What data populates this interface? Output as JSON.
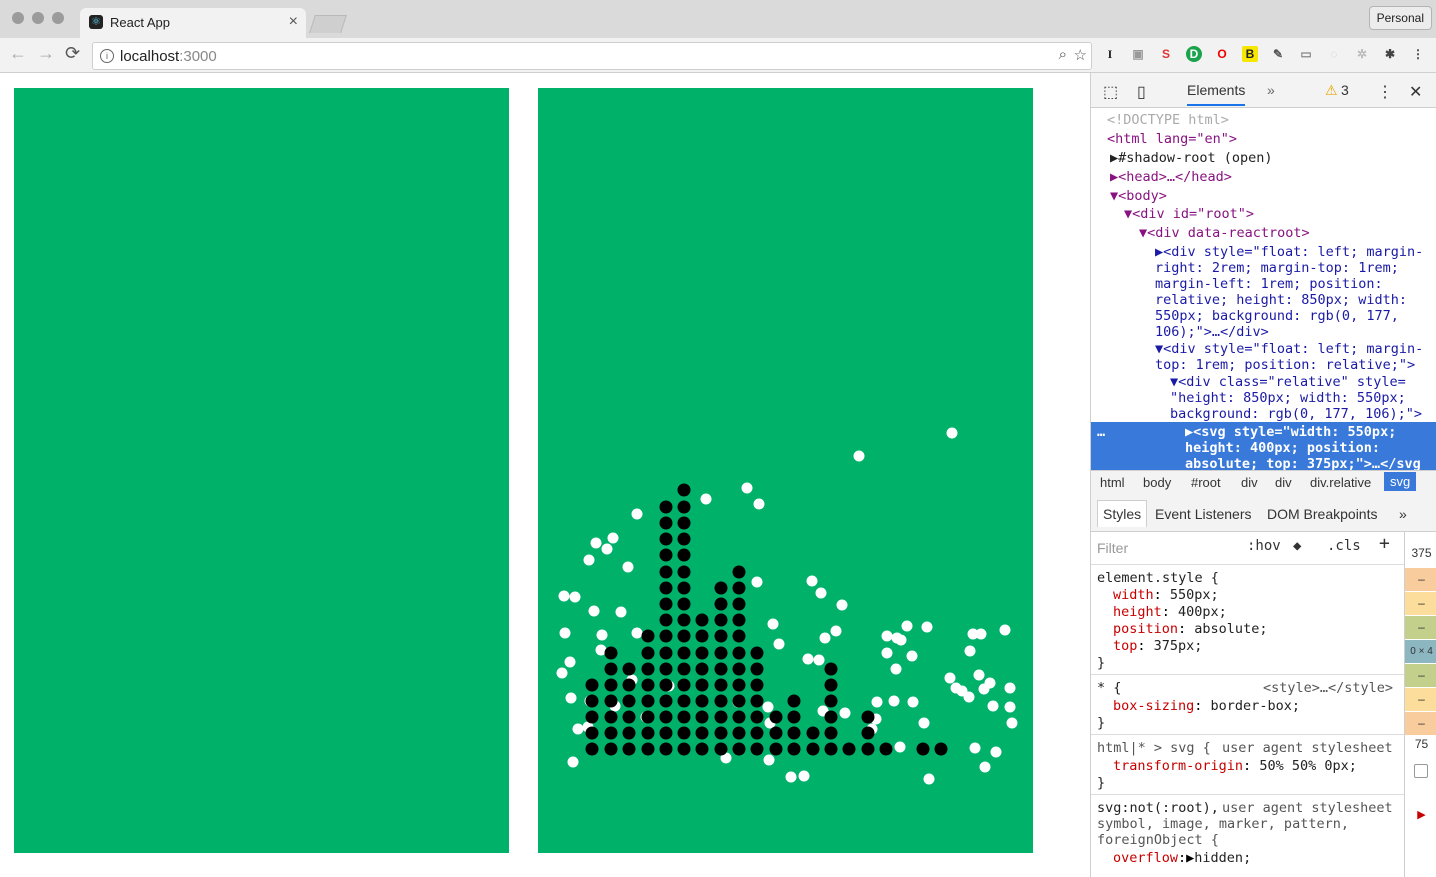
{
  "browser": {
    "tab_title": "React App",
    "tab_close": "×",
    "profile_label": "Personal",
    "url_host": "localhost",
    "url_port": ":3000",
    "nav": {
      "back": "←",
      "forward": "→",
      "reload": "⟳"
    },
    "extensions": [
      "I",
      "S",
      "D",
      "O",
      "B"
    ]
  },
  "page": {
    "background_color": "#00b16a",
    "scatter": {
      "black_points": [
        [
          684,
          490
        ],
        [
          666,
          507
        ],
        [
          684,
          507
        ],
        [
          666,
          523
        ],
        [
          684,
          523
        ],
        [
          666,
          539
        ],
        [
          684,
          539
        ],
        [
          666,
          555
        ],
        [
          684,
          555
        ],
        [
          666,
          572
        ],
        [
          684,
          572
        ],
        [
          739,
          572
        ],
        [
          666,
          588
        ],
        [
          684,
          588
        ],
        [
          721,
          588
        ],
        [
          739,
          588
        ],
        [
          666,
          604
        ],
        [
          684,
          604
        ],
        [
          721,
          604
        ],
        [
          739,
          604
        ],
        [
          666,
          620
        ],
        [
          684,
          620
        ],
        [
          702,
          620
        ],
        [
          721,
          620
        ],
        [
          739,
          620
        ],
        [
          648,
          636
        ],
        [
          666,
          636
        ],
        [
          684,
          636
        ],
        [
          702,
          636
        ],
        [
          721,
          636
        ],
        [
          739,
          636
        ],
        [
          611,
          653
        ],
        [
          648,
          653
        ],
        [
          666,
          653
        ],
        [
          684,
          653
        ],
        [
          702,
          653
        ],
        [
          721,
          653
        ],
        [
          739,
          653
        ],
        [
          757,
          653
        ],
        [
          611,
          669
        ],
        [
          629,
          669
        ],
        [
          648,
          669
        ],
        [
          666,
          669
        ],
        [
          684,
          669
        ],
        [
          702,
          669
        ],
        [
          721,
          669
        ],
        [
          739,
          669
        ],
        [
          757,
          669
        ],
        [
          831,
          669
        ],
        [
          592,
          685
        ],
        [
          611,
          685
        ],
        [
          629,
          685
        ],
        [
          648,
          685
        ],
        [
          666,
          685
        ],
        [
          684,
          685
        ],
        [
          702,
          685
        ],
        [
          721,
          685
        ],
        [
          739,
          685
        ],
        [
          757,
          685
        ],
        [
          831,
          685
        ],
        [
          592,
          701
        ],
        [
          611,
          701
        ],
        [
          629,
          701
        ],
        [
          648,
          701
        ],
        [
          666,
          701
        ],
        [
          684,
          701
        ],
        [
          702,
          701
        ],
        [
          721,
          701
        ],
        [
          739,
          701
        ],
        [
          757,
          701
        ],
        [
          794,
          701
        ],
        [
          831,
          701
        ],
        [
          592,
          717
        ],
        [
          611,
          717
        ],
        [
          629,
          717
        ],
        [
          648,
          717
        ],
        [
          666,
          717
        ],
        [
          684,
          717
        ],
        [
          702,
          717
        ],
        [
          721,
          717
        ],
        [
          739,
          717
        ],
        [
          757,
          717
        ],
        [
          776,
          717
        ],
        [
          794,
          717
        ],
        [
          831,
          717
        ],
        [
          868,
          717
        ],
        [
          592,
          733
        ],
        [
          611,
          733
        ],
        [
          629,
          733
        ],
        [
          648,
          733
        ],
        [
          666,
          733
        ],
        [
          684,
          733
        ],
        [
          702,
          733
        ],
        [
          721,
          733
        ],
        [
          739,
          733
        ],
        [
          757,
          733
        ],
        [
          776,
          733
        ],
        [
          794,
          733
        ],
        [
          813,
          733
        ],
        [
          831,
          733
        ],
        [
          868,
          733
        ],
        [
          592,
          749
        ],
        [
          611,
          749
        ],
        [
          629,
          749
        ],
        [
          648,
          749
        ],
        [
          666,
          749
        ],
        [
          684,
          749
        ],
        [
          702,
          749
        ],
        [
          721,
          749
        ],
        [
          739,
          749
        ],
        [
          757,
          749
        ],
        [
          776,
          749
        ],
        [
          794,
          749
        ],
        [
          813,
          749
        ],
        [
          831,
          749
        ],
        [
          849,
          749
        ],
        [
          868,
          749
        ],
        [
          886,
          749
        ],
        [
          923,
          749
        ],
        [
          941,
          749
        ]
      ],
      "white_points": [
        [
          952,
          433
        ],
        [
          859,
          456
        ],
        [
          747,
          488
        ],
        [
          706,
          499
        ],
        [
          759,
          504
        ],
        [
          637,
          514
        ],
        [
          613,
          538
        ],
        [
          596,
          543
        ],
        [
          607,
          549
        ],
        [
          589,
          560
        ],
        [
          628,
          567
        ],
        [
          757,
          582
        ],
        [
          812,
          581
        ],
        [
          821,
          593
        ],
        [
          564,
          596
        ],
        [
          575,
          597
        ],
        [
          842,
          605
        ],
        [
          594,
          611
        ],
        [
          621,
          612
        ],
        [
          773,
          624
        ],
        [
          907,
          626
        ],
        [
          927,
          627
        ],
        [
          836,
          631
        ],
        [
          565,
          633
        ],
        [
          602,
          635
        ],
        [
          637,
          633
        ],
        [
          887,
          636
        ],
        [
          897,
          638
        ],
        [
          901,
          640
        ],
        [
          1005,
          630
        ],
        [
          973,
          634
        ],
        [
          981,
          634
        ],
        [
          825,
          638
        ],
        [
          779,
          644
        ],
        [
          601,
          650
        ],
        [
          808,
          659
        ],
        [
          887,
          653
        ],
        [
          970,
          651
        ],
        [
          819,
          660
        ],
        [
          912,
          656
        ],
        [
          570,
          662
        ],
        [
          562,
          673
        ],
        [
          896,
          669
        ],
        [
          950,
          678
        ],
        [
          979,
          675
        ],
        [
          632,
          680
        ],
        [
          669,
          686
        ],
        [
          990,
          683
        ],
        [
          956,
          688
        ],
        [
          1010,
          688
        ],
        [
          984,
          689
        ],
        [
          962,
          691
        ],
        [
          969,
          697
        ],
        [
          571,
          698
        ],
        [
          590,
          701
        ],
        [
          615,
          706
        ],
        [
          738,
          702
        ],
        [
          877,
          702
        ],
        [
          894,
          701
        ],
        [
          768,
          707
        ],
        [
          913,
          702
        ],
        [
          993,
          706
        ],
        [
          1010,
          707
        ],
        [
          1012,
          723
        ],
        [
          845,
          713
        ],
        [
          924,
          723
        ],
        [
          588,
          727
        ],
        [
          770,
          723
        ],
        [
          823,
          711
        ],
        [
          876,
          719
        ],
        [
          872,
          729
        ],
        [
          646,
          717
        ],
        [
          578,
          729
        ],
        [
          900,
          747
        ],
        [
          975,
          748
        ],
        [
          996,
          752
        ],
        [
          573,
          762
        ],
        [
          726,
          758
        ],
        [
          769,
          760
        ],
        [
          985,
          767
        ],
        [
          791,
          777
        ],
        [
          804,
          776
        ],
        [
          929,
          779
        ]
      ]
    }
  },
  "devtools": {
    "tab_elements": "Elements",
    "more_tabs": "»",
    "warning_count": "3",
    "dom_lines": [
      {
        "text": "<!DOCTYPE html>"
      },
      {
        "text": "<html lang=\"en\">"
      },
      {
        "text": "▶#shadow-root (open)"
      },
      {
        "text": "▶<head>…</head>"
      },
      {
        "text": "▼<body>"
      },
      {
        "text": "▼<div id=\"root\">"
      },
      {
        "text": "▼<div data-reactroot>"
      },
      {
        "text": "▶<div style=\"float: left; margin-"
      },
      {
        "text": "right: 2rem; margin-top: 1rem;"
      },
      {
        "text": "margin-left: 1rem; position:"
      },
      {
        "text": "relative; height: 850px; width:"
      },
      {
        "text": "550px; background: rgb(0, 177,"
      },
      {
        "text": "106);\">…</div>"
      },
      {
        "text": "▼<div style=\"float: left; margin-"
      },
      {
        "text": "top: 1rem; position: relative;\">"
      },
      {
        "text": "▼<div class=\"relative\" style="
      },
      {
        "text": "\"height: 850px; width: 550px;"
      },
      {
        "text": "background: rgb(0, 177, 106);\">"
      }
    ],
    "selected_lines": [
      "▶<svg style=\"width: 550px;",
      "height: 400px; position:",
      "absolute; top: 375px;\">…</svg"
    ],
    "crumbs": [
      "html",
      "body",
      "#root",
      "div",
      "div",
      "div.relative",
      "svg"
    ],
    "subtabs": [
      "Styles",
      "Event Listeners",
      "DOM Breakpoints",
      "»"
    ],
    "filter_placeholder": "Filter",
    "filter_hov": ":hov",
    "filter_cls": ".cls",
    "filter_add": "+",
    "styles": {
      "element_selector": "element.style {",
      "element_props": [
        {
          "name": "width",
          "value": "550px;"
        },
        {
          "name": "height",
          "value": "400px;"
        },
        {
          "name": "position",
          "value": "absolute;"
        },
        {
          "name": "top",
          "value": "375px;"
        }
      ],
      "close": "}",
      "star_selector": "* {",
      "star_origin": "<style>…</style>",
      "star_prop": {
        "name": "box-sizing",
        "value": "border-box;"
      },
      "svg_selector": "html|* > svg {",
      "svg_origin": "user agent stylesheet",
      "svg_prop": {
        "name": "transform-origin",
        "value": "50% 50% 0px;"
      },
      "svgnot_selector": "svg:not(:root),",
      "svgnot_origin": "user agent stylesheet",
      "svgnot_more_1": "symbol, image, marker, pattern,",
      "svgnot_more_2": "foreignObject {",
      "svgnot_prop": {
        "name": "overflow",
        "value": "hidden;"
      }
    },
    "boxmodel": {
      "top": "375",
      "dash": "–",
      "size": "0 × 4",
      "bottom": "75"
    }
  }
}
